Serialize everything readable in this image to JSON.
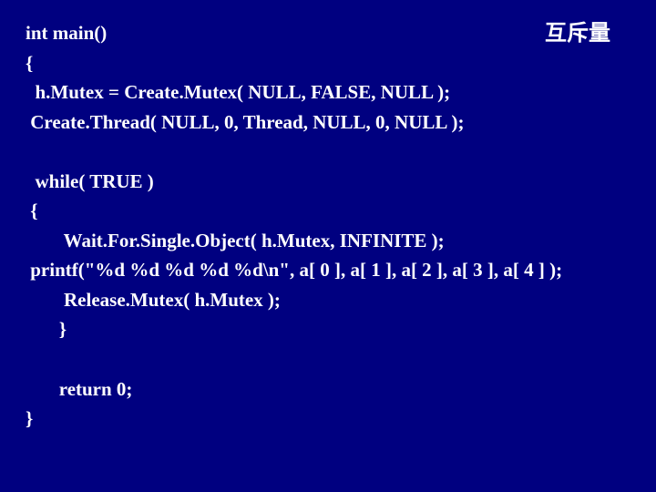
{
  "title": "互斥量",
  "code": {
    "l1": "int main()",
    "l2": "{",
    "l3": "  h.Mutex = Create.Mutex( NULL, FALSE, NULL );",
    "l4": " Create.Thread( NULL, 0, Thread, NULL, 0, NULL );",
    "l5": "",
    "l6": "  while( TRUE )",
    "l7": " {",
    "l8": "        Wait.For.Single.Object( h.Mutex, INFINITE );",
    "l9": " printf(\"%d %d %d %d %d\\n\", a[ 0 ], a[ 1 ], a[ 2 ], a[ 3 ], a[ 4 ] );",
    "l10": "        Release.Mutex( h.Mutex );",
    "l11": "       }",
    "l12": "",
    "l13": "       return 0;",
    "l14": "}"
  }
}
